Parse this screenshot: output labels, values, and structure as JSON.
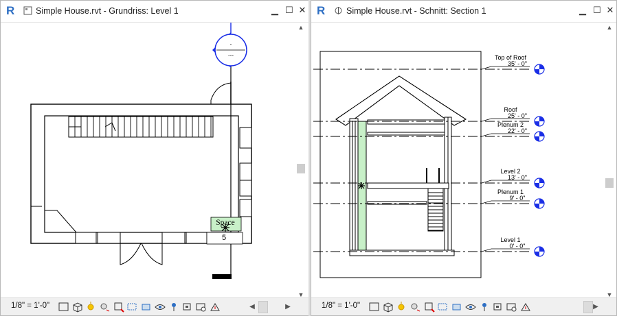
{
  "left_view": {
    "title": "Simple House.rvt - Grundriss: Level 1",
    "scale": "1/8\" = 1'-0\"",
    "room_name": "Space",
    "room_number": "5",
    "callout_top": "-",
    "callout_bottom": "---"
  },
  "right_view": {
    "title": "Simple House.rvt - Schnitt: Section 1",
    "scale": "1/8\" = 1'-0\"",
    "levels": [
      {
        "name": "Top of Roof",
        "elevation": "35' - 0\""
      },
      {
        "name": "Roof",
        "elevation": "25' - 0\""
      },
      {
        "name": "Plenum 2",
        "elevation": "22' - 0\""
      },
      {
        "name": "Level 2",
        "elevation": "13' - 0\""
      },
      {
        "name": "Plenum 1",
        "elevation": "9' - 0\""
      },
      {
        "name": "Level 1",
        "elevation": "0' - 0\""
      }
    ]
  },
  "window_controls": {
    "minimize": "▁",
    "maximize": "☐",
    "close": "✕"
  },
  "app_logo": "R",
  "colors": {
    "level_head": "#1a2ee6",
    "highlight": "#c8f0c8",
    "logo": "#2e6fc4"
  },
  "toolbar_icons": [
    "visual-style-icon",
    "3d-box-icon",
    "sun-path-icon",
    "shadows-icon",
    "crop-view-icon",
    "show-crop-icon",
    "temporary-hide-icon",
    "reveal-hidden-icon",
    "pin-icon",
    "worksharing-icon",
    "analysis-icon",
    "highlight-icon"
  ]
}
